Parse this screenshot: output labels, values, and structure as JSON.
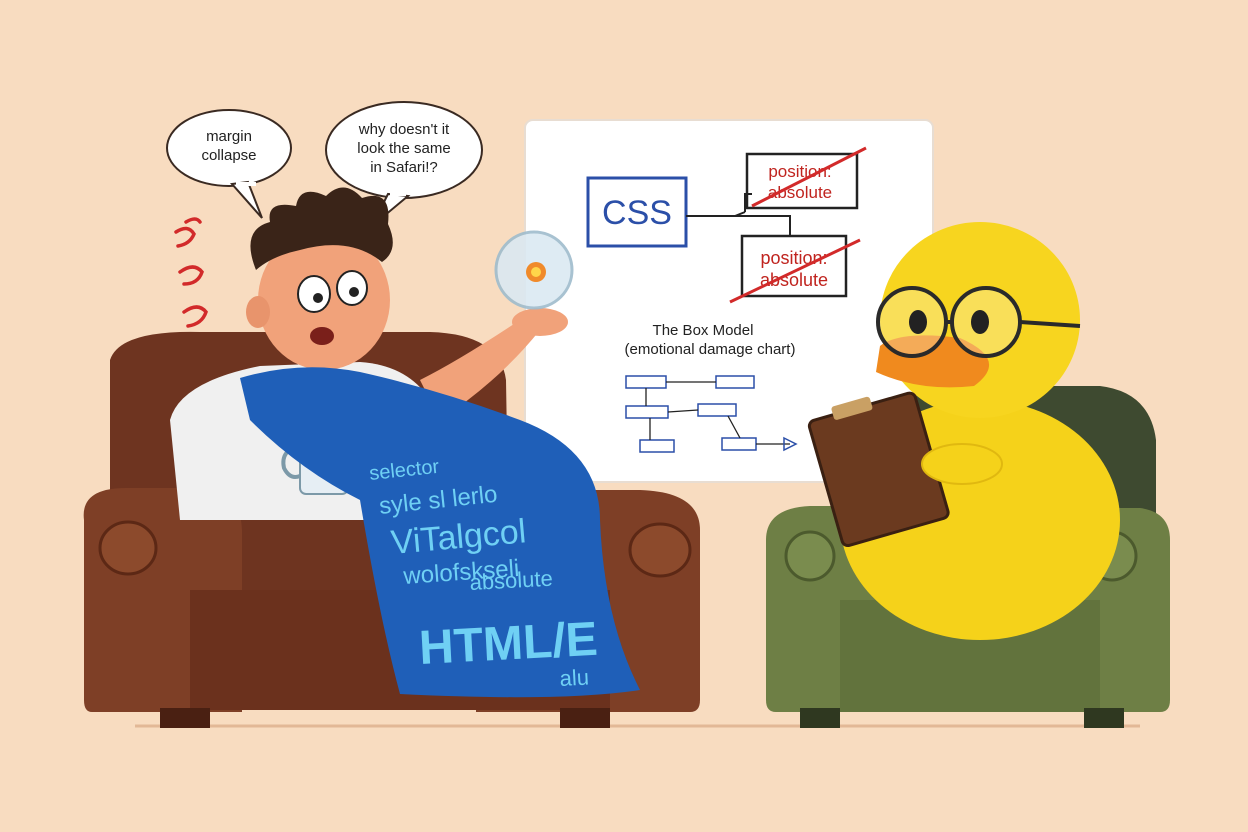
{
  "bubbles": {
    "left": [
      "margin",
      "collapse"
    ],
    "right": [
      "why doesn't it",
      "look the same",
      "in Safari!?"
    ]
  },
  "whiteboard": {
    "css_label": "CSS",
    "box1": [
      "position:",
      "absolute"
    ],
    "box2": [
      "position:",
      "absolute"
    ],
    "title_line1": "The Box Model",
    "title_line2": "(emotional damage chart)"
  },
  "blanket": {
    "lines": [
      "selector",
      "syle sl lerlo",
      "ViTalgcol",
      "wolofskseli",
      "absolute",
      "HTML/E",
      "alu"
    ]
  },
  "colors": {
    "background": "#f8dcc0",
    "left_armchair": "#7a3a22",
    "right_armchair": "#6e7f45",
    "duck": "#f5d21a",
    "blanket": "#1f5fb8",
    "accent_red": "#d22a2a",
    "accent_blue": "#2b4fa8"
  }
}
